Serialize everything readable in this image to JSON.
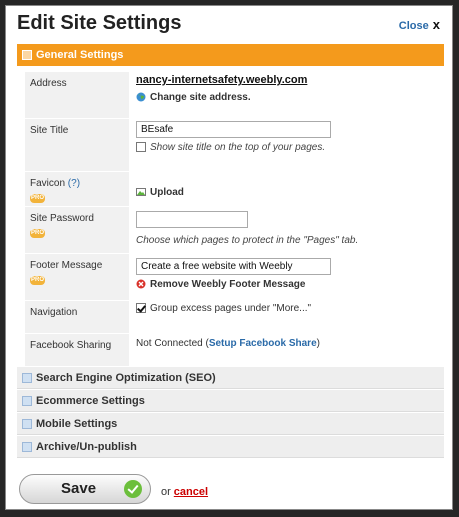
{
  "dialog": {
    "title": "Edit Site Settings",
    "close_label": "Close",
    "close_x": "x"
  },
  "general": {
    "header": "General Settings",
    "address": {
      "label": "Address",
      "url": "nancy-internetsafety.weebly.com",
      "change": "Change site address."
    },
    "site_title": {
      "label": "Site Title",
      "value": "BEsafe",
      "checkbox_label": "Show site title on the top of your pages.",
      "checked": false
    },
    "favicon": {
      "label": "Favicon",
      "help": "(?)",
      "pro_badge": "PRO",
      "upload": "Upload"
    },
    "site_password": {
      "label": "Site Password",
      "pro_badge": "PRO",
      "value": "",
      "hint": "Choose which pages to protect in the \"Pages\" tab."
    },
    "footer_message": {
      "label": "Footer Message",
      "pro_badge": "PRO",
      "value": "Create a free website with Weebly",
      "remove": "Remove Weebly Footer Message"
    },
    "navigation": {
      "label": "Navigation",
      "checkbox_label": "Group excess pages under \"More...\"",
      "checked": true
    },
    "facebook": {
      "label": "Facebook Sharing",
      "status": "Not Connected (",
      "setup": "Setup Facebook Share",
      "close_paren": ")"
    }
  },
  "sections": [
    {
      "label": "Search Engine Optimization (SEO)"
    },
    {
      "label": "Ecommerce Settings"
    },
    {
      "label": "Mobile Settings"
    },
    {
      "label": "Archive/Un-publish"
    }
  ],
  "footer": {
    "save": "Save",
    "or": "or",
    "cancel": "cancel"
  },
  "colors": {
    "accent": "#f49a1c",
    "link": "#2a6aa8",
    "cancel": "#cc0000",
    "confirm": "#6cbf3c"
  },
  "icons": {
    "globe": "globe-icon",
    "upload": "image-upload-icon",
    "remove": "remove-icon",
    "check": "checkmark-icon"
  }
}
